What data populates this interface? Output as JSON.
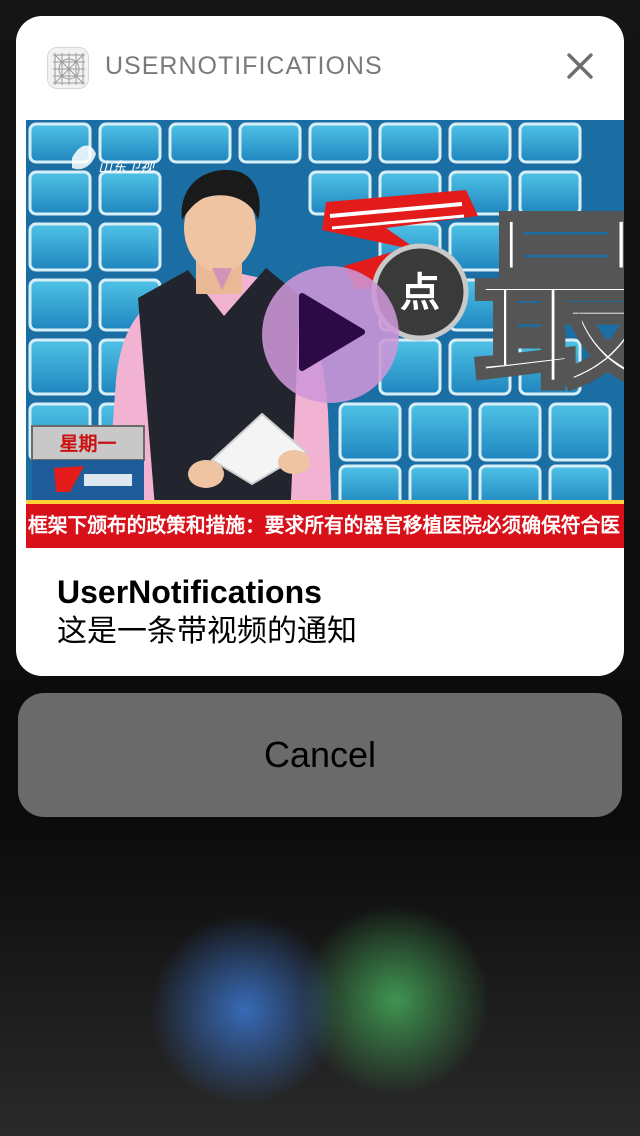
{
  "notification": {
    "app_name": "USERNOTIFICATIONS",
    "app_icon": "grid-app-icon",
    "close_icon": "close-icon",
    "title": "UserNotifications",
    "body": "这是一条带视频的通知"
  },
  "video": {
    "play_icon": "play-icon",
    "weekday_label": "星期一",
    "channel_logo_label": "山东卫视",
    "program_logo_text": "点",
    "program_logo_big_char": "最",
    "ticker_text": "框架下颁布的政策和措施：要求所有的器官移植医院必须确保符合医"
  },
  "actions": {
    "cancel_label": "Cancel"
  },
  "colors": {
    "card_background": "#ffffff",
    "cancel_background": "#6a6a6a",
    "play_button": "#cd96d7",
    "play_triangle": "#2b0a45",
    "ticker_red": "#d8101a"
  }
}
